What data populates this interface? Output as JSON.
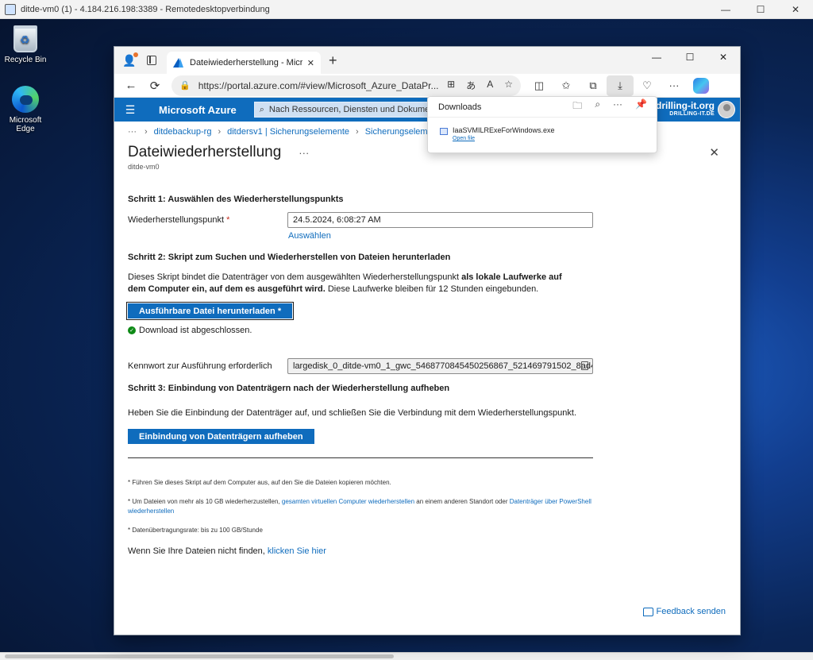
{
  "rdp": {
    "title": "ditde-vm0 (1) - 4.184.216.198:3389 - Remotedesktopverbindung",
    "controls": [
      "—",
      "☐",
      "✕"
    ]
  },
  "desktop": {
    "icons": [
      {
        "label": "Recycle Bin",
        "icon": "recycle-bin-icon"
      },
      {
        "label": "Microsoft Edge",
        "icon": "edge-icon"
      }
    ]
  },
  "browser": {
    "tab_title": "Dateiwiederherstellung - Microso",
    "tab_close": "✕",
    "new_tab": "+",
    "win_controls": [
      "—",
      "☐",
      "✕"
    ],
    "url": "https://portal.azure.com/#view/Microsoft_Azure_DataPr...",
    "nav": {
      "back": "←",
      "refresh": "⟳"
    }
  },
  "azure": {
    "brand": "Microsoft Azure",
    "search_placeholder": "Nach Ressourcen, Diensten und Dokumenten",
    "account_email": "@drilling-it.org",
    "account_directory": "DRILLING-IT.DE"
  },
  "downloads": {
    "title": "Downloads",
    "file_name": "IaaSVMILRExeForWindows.exe",
    "open_file": "Open file"
  },
  "page": {
    "breadcrumb": [
      "ditdebackup-rg",
      "ditdersv1 | Sicherungselemente",
      "Sicherungselemente"
    ],
    "breadcrumb_more": "···",
    "title": "Dateiwiederherstellung",
    "title_more": "···",
    "subtitle": "ditde-vm0",
    "step1_heading": "Schritt 1: Auswählen des Wiederherstellungspunkts",
    "restore_point_label": "Wiederherstellungspunkt",
    "required_mark": "*",
    "restore_point_value": "24.5.2024, 6:08:27 AM",
    "select_link": "Auswählen",
    "step2_heading": "Schritt 2: Skript zum Suchen und Wiederherstellen von Dateien herunterladen",
    "step2_text_1": "Dieses Skript bindet die Datenträger von dem ausgewählten Wiederherstellungspunkt ",
    "step2_text_bold": "als lokale Laufwerke auf dem Computer ein, auf dem es ausgeführt wird.",
    "step2_text_2": " Diese Laufwerke bleiben für 12 Stunden eingebunden.",
    "download_button": "Ausführbare Datei herunterladen *",
    "download_status": "Download ist abgeschlossen.",
    "password_label": "Kennwort zur Ausführung erforderlich",
    "password_value": "largedisk_0_ditde-vm0_1_gwc_5468770845450256867_521469791502_8ad4...",
    "step3_heading": "Schritt 3: Einbindung von Datenträgern nach der Wiederherstellung aufheben",
    "step3_text": "Heben Sie die Einbindung der Datenträger auf, und schließen Sie die Verbindung mit dem Wiederherstellungspunkt.",
    "unmount_button": "Einbindung von Datenträgern aufheben",
    "note1": "* Führen Sie dieses Skript auf dem Computer aus, auf den Sie die Dateien kopieren möchten.",
    "note2_a": "* Um Dateien von mehr als 10 GB wiederherzustellen, ",
    "note2_link1": "gesamten virtuellen Computer wiederherstellen",
    "note2_b": " an einem anderen Standort oder ",
    "note2_link2": "Datenträger über PowerShell wiederherstellen",
    "note3": "* Datenübertragungsrate: bis zu 100 GB/Stunde",
    "not_found_text": "Wenn Sie Ihre Dateien nicht finden, ",
    "not_found_link": "klicken Sie hier",
    "feedback": "Feedback senden"
  },
  "colors": {
    "azure_blue": "#0f6cbd",
    "success_green": "#0e8a16",
    "required_red": "#c42b1c"
  }
}
